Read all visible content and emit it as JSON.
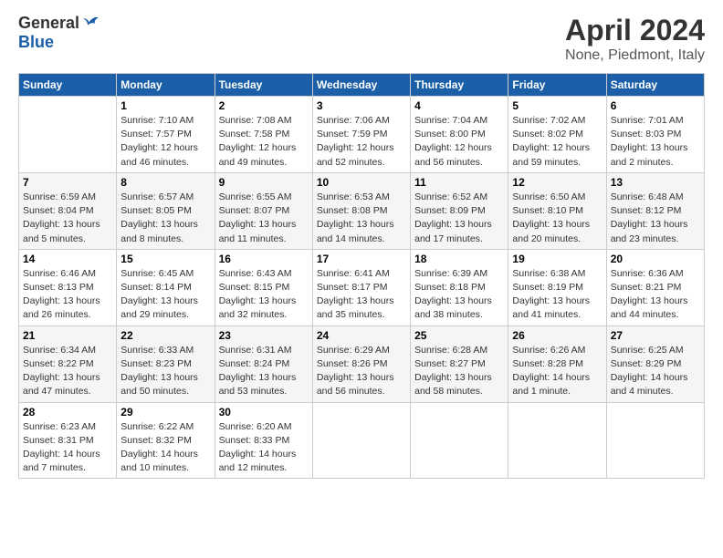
{
  "header": {
    "logo_general": "General",
    "logo_blue": "Blue",
    "month_title": "April 2024",
    "location": "None, Piedmont, Italy"
  },
  "days_of_week": [
    "Sunday",
    "Monday",
    "Tuesday",
    "Wednesday",
    "Thursday",
    "Friday",
    "Saturday"
  ],
  "weeks": [
    [
      {
        "day": "",
        "info": ""
      },
      {
        "day": "1",
        "info": "Sunrise: 7:10 AM\nSunset: 7:57 PM\nDaylight: 12 hours\nand 46 minutes."
      },
      {
        "day": "2",
        "info": "Sunrise: 7:08 AM\nSunset: 7:58 PM\nDaylight: 12 hours\nand 49 minutes."
      },
      {
        "day": "3",
        "info": "Sunrise: 7:06 AM\nSunset: 7:59 PM\nDaylight: 12 hours\nand 52 minutes."
      },
      {
        "day": "4",
        "info": "Sunrise: 7:04 AM\nSunset: 8:00 PM\nDaylight: 12 hours\nand 56 minutes."
      },
      {
        "day": "5",
        "info": "Sunrise: 7:02 AM\nSunset: 8:02 PM\nDaylight: 12 hours\nand 59 minutes."
      },
      {
        "day": "6",
        "info": "Sunrise: 7:01 AM\nSunset: 8:03 PM\nDaylight: 13 hours\nand 2 minutes."
      }
    ],
    [
      {
        "day": "7",
        "info": "Sunrise: 6:59 AM\nSunset: 8:04 PM\nDaylight: 13 hours\nand 5 minutes."
      },
      {
        "day": "8",
        "info": "Sunrise: 6:57 AM\nSunset: 8:05 PM\nDaylight: 13 hours\nand 8 minutes."
      },
      {
        "day": "9",
        "info": "Sunrise: 6:55 AM\nSunset: 8:07 PM\nDaylight: 13 hours\nand 11 minutes."
      },
      {
        "day": "10",
        "info": "Sunrise: 6:53 AM\nSunset: 8:08 PM\nDaylight: 13 hours\nand 14 minutes."
      },
      {
        "day": "11",
        "info": "Sunrise: 6:52 AM\nSunset: 8:09 PM\nDaylight: 13 hours\nand 17 minutes."
      },
      {
        "day": "12",
        "info": "Sunrise: 6:50 AM\nSunset: 8:10 PM\nDaylight: 13 hours\nand 20 minutes."
      },
      {
        "day": "13",
        "info": "Sunrise: 6:48 AM\nSunset: 8:12 PM\nDaylight: 13 hours\nand 23 minutes."
      }
    ],
    [
      {
        "day": "14",
        "info": "Sunrise: 6:46 AM\nSunset: 8:13 PM\nDaylight: 13 hours\nand 26 minutes."
      },
      {
        "day": "15",
        "info": "Sunrise: 6:45 AM\nSunset: 8:14 PM\nDaylight: 13 hours\nand 29 minutes."
      },
      {
        "day": "16",
        "info": "Sunrise: 6:43 AM\nSunset: 8:15 PM\nDaylight: 13 hours\nand 32 minutes."
      },
      {
        "day": "17",
        "info": "Sunrise: 6:41 AM\nSunset: 8:17 PM\nDaylight: 13 hours\nand 35 minutes."
      },
      {
        "day": "18",
        "info": "Sunrise: 6:39 AM\nSunset: 8:18 PM\nDaylight: 13 hours\nand 38 minutes."
      },
      {
        "day": "19",
        "info": "Sunrise: 6:38 AM\nSunset: 8:19 PM\nDaylight: 13 hours\nand 41 minutes."
      },
      {
        "day": "20",
        "info": "Sunrise: 6:36 AM\nSunset: 8:21 PM\nDaylight: 13 hours\nand 44 minutes."
      }
    ],
    [
      {
        "day": "21",
        "info": "Sunrise: 6:34 AM\nSunset: 8:22 PM\nDaylight: 13 hours\nand 47 minutes."
      },
      {
        "day": "22",
        "info": "Sunrise: 6:33 AM\nSunset: 8:23 PM\nDaylight: 13 hours\nand 50 minutes."
      },
      {
        "day": "23",
        "info": "Sunrise: 6:31 AM\nSunset: 8:24 PM\nDaylight: 13 hours\nand 53 minutes."
      },
      {
        "day": "24",
        "info": "Sunrise: 6:29 AM\nSunset: 8:26 PM\nDaylight: 13 hours\nand 56 minutes."
      },
      {
        "day": "25",
        "info": "Sunrise: 6:28 AM\nSunset: 8:27 PM\nDaylight: 13 hours\nand 58 minutes."
      },
      {
        "day": "26",
        "info": "Sunrise: 6:26 AM\nSunset: 8:28 PM\nDaylight: 14 hours\nand 1 minute."
      },
      {
        "day": "27",
        "info": "Sunrise: 6:25 AM\nSunset: 8:29 PM\nDaylight: 14 hours\nand 4 minutes."
      }
    ],
    [
      {
        "day": "28",
        "info": "Sunrise: 6:23 AM\nSunset: 8:31 PM\nDaylight: 14 hours\nand 7 minutes."
      },
      {
        "day": "29",
        "info": "Sunrise: 6:22 AM\nSunset: 8:32 PM\nDaylight: 14 hours\nand 10 minutes."
      },
      {
        "day": "30",
        "info": "Sunrise: 6:20 AM\nSunset: 8:33 PM\nDaylight: 14 hours\nand 12 minutes."
      },
      {
        "day": "",
        "info": ""
      },
      {
        "day": "",
        "info": ""
      },
      {
        "day": "",
        "info": ""
      },
      {
        "day": "",
        "info": ""
      }
    ]
  ]
}
